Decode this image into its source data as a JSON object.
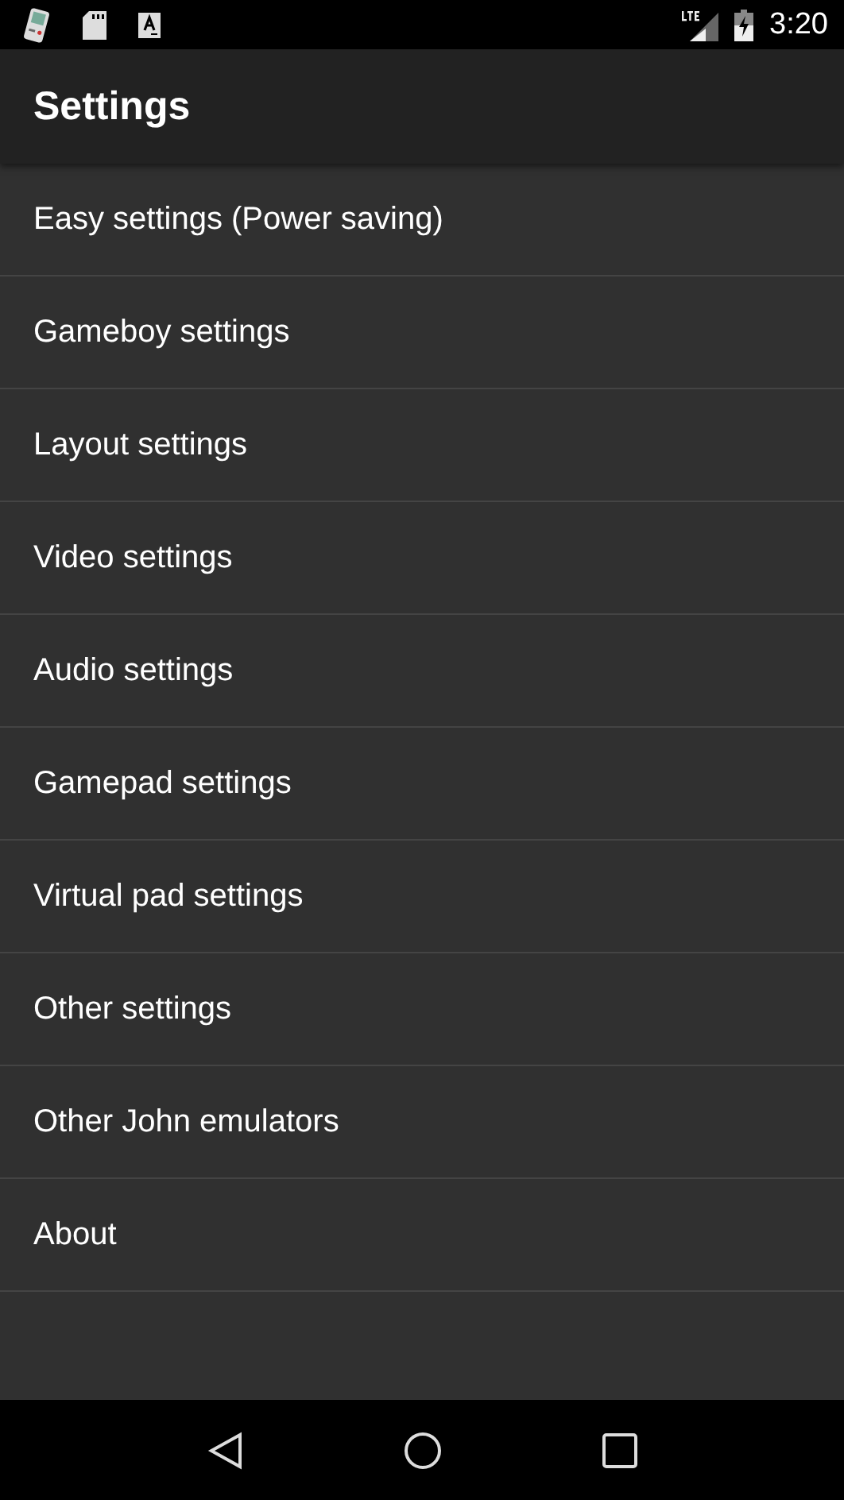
{
  "status_bar": {
    "time": "3:20"
  },
  "app_bar": {
    "title": "Settings"
  },
  "settings": [
    {
      "label": "Easy settings (Power saving)"
    },
    {
      "label": "Gameboy settings"
    },
    {
      "label": "Layout settings"
    },
    {
      "label": "Video settings"
    },
    {
      "label": "Audio settings"
    },
    {
      "label": "Gamepad settings"
    },
    {
      "label": "Virtual pad settings"
    },
    {
      "label": "Other settings"
    },
    {
      "label": "Other John emulators"
    },
    {
      "label": "About"
    }
  ]
}
